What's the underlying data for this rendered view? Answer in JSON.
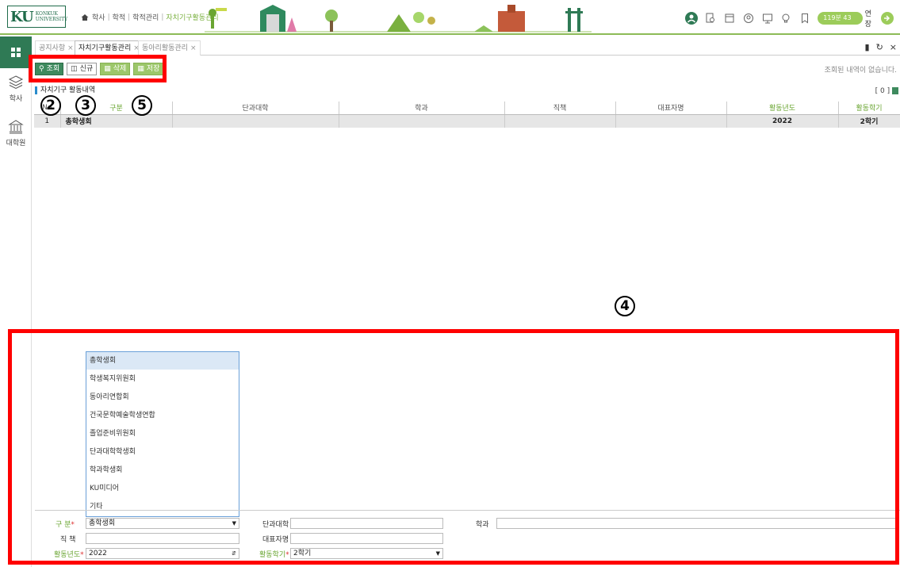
{
  "header": {
    "logo_mark": "KU",
    "logo_line1": "KONKUK",
    "logo_line2": "UNIVERSITY",
    "breadcrumb": [
      "학사",
      "학적",
      "학적관리",
      "자치기구활동관리"
    ],
    "timer": "119분 43초",
    "extend_label": "연장"
  },
  "rail": {
    "items": [
      {
        "label": "학사",
        "icon": "layers-icon"
      },
      {
        "label": "대학원",
        "icon": "building-icon"
      }
    ]
  },
  "tabs": [
    {
      "label": "공지사항",
      "active": false
    },
    {
      "label": "자치기구활동관리",
      "active": true
    },
    {
      "label": "동아리활동관리",
      "active": false
    }
  ],
  "toolbar": {
    "search_label": "조회",
    "new_label": "신규",
    "delete_label": "삭제",
    "save_label": "저장",
    "status_msg": "조회된 내역이 없습니다."
  },
  "section": {
    "title": "자치기구 활동내역",
    "count_text": "[ 0 ]"
  },
  "grid": {
    "columns": [
      "No",
      "구분",
      "단과대학",
      "학과",
      "직책",
      "대표자명",
      "활동년도",
      "활동학기"
    ],
    "rows": [
      {
        "no": "1",
        "type": "총학생회",
        "college": "",
        "dept": "",
        "position": "",
        "rep": "",
        "year": "2022",
        "semester": "2학기"
      }
    ]
  },
  "annotations": {
    "marker_2": "2",
    "marker_3": "3",
    "marker_4": "4",
    "marker_5": "5",
    "highlight_color": "#ff0000"
  },
  "dropdown": {
    "options": [
      "총학생회",
      "학생복지위원회",
      "동아리연합회",
      "건국문학예술학생연합",
      "졸업준비위원회",
      "단과대학학생회",
      "학과학생회",
      "KU미디어",
      "기타"
    ],
    "selected": "총학생회"
  },
  "form": {
    "type_label": "구 분",
    "type_value": "총학생회",
    "college_label": "단과대학",
    "college_value": "",
    "dept_label": "학과",
    "dept_value": "",
    "position_label": "직 책",
    "position_value": "",
    "rep_label": "대표자명",
    "rep_value": "",
    "year_label": "활동년도",
    "year_value": "2022",
    "semester_label": "활동학기",
    "semester_value": "2학기",
    "required_mark": "*"
  },
  "colors": {
    "brand_green": "#2f7a55",
    "accent_lime": "#9ccc5a",
    "header_green": "#6aa532"
  }
}
